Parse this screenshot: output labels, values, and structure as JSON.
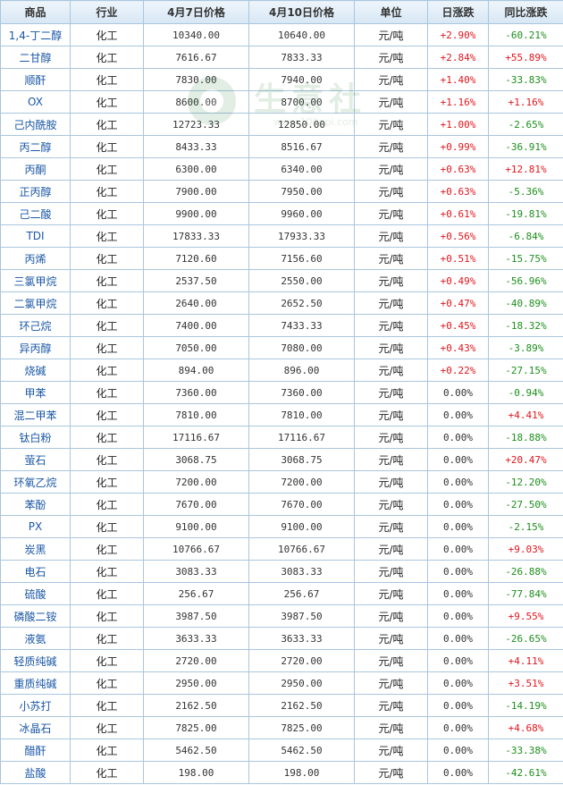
{
  "table": {
    "headers": [
      "商品",
      "行业",
      "4月7日价格",
      "4月10日价格",
      "单位",
      "日涨跌",
      "同比涨跌"
    ],
    "rows": [
      {
        "name": "1,4-丁二醇",
        "industry": "化工",
        "p1": "10340.00",
        "p2": "10640.00",
        "unit": "元/吨",
        "daily": "+2.90%",
        "yoy": "-60.21%"
      },
      {
        "name": "二甘醇",
        "industry": "化工",
        "p1": "7616.67",
        "p2": "7833.33",
        "unit": "元/吨",
        "daily": "+2.84%",
        "yoy": "+55.89%"
      },
      {
        "name": "顺酐",
        "industry": "化工",
        "p1": "7830.00",
        "p2": "7940.00",
        "unit": "元/吨",
        "daily": "+1.40%",
        "yoy": "-33.83%"
      },
      {
        "name": "OX",
        "industry": "化工",
        "p1": "8600.00",
        "p2": "8700.00",
        "unit": "元/吨",
        "daily": "+1.16%",
        "yoy": "+1.16%"
      },
      {
        "name": "己内酰胺",
        "industry": "化工",
        "p1": "12723.33",
        "p2": "12850.00",
        "unit": "元/吨",
        "daily": "+1.00%",
        "yoy": "-2.65%"
      },
      {
        "name": "丙二醇",
        "industry": "化工",
        "p1": "8433.33",
        "p2": "8516.67",
        "unit": "元/吨",
        "daily": "+0.99%",
        "yoy": "-36.91%"
      },
      {
        "name": "丙酮",
        "industry": "化工",
        "p1": "6300.00",
        "p2": "6340.00",
        "unit": "元/吨",
        "daily": "+0.63%",
        "yoy": "+12.81%"
      },
      {
        "name": "正丙醇",
        "industry": "化工",
        "p1": "7900.00",
        "p2": "7950.00",
        "unit": "元/吨",
        "daily": "+0.63%",
        "yoy": "-5.36%"
      },
      {
        "name": "己二酸",
        "industry": "化工",
        "p1": "9900.00",
        "p2": "9960.00",
        "unit": "元/吨",
        "daily": "+0.61%",
        "yoy": "-19.81%"
      },
      {
        "name": "TDI",
        "industry": "化工",
        "p1": "17833.33",
        "p2": "17933.33",
        "unit": "元/吨",
        "daily": "+0.56%",
        "yoy": "-6.84%"
      },
      {
        "name": "丙烯",
        "industry": "化工",
        "p1": "7120.60",
        "p2": "7156.60",
        "unit": "元/吨",
        "daily": "+0.51%",
        "yoy": "-15.75%"
      },
      {
        "name": "三氯甲烷",
        "industry": "化工",
        "p1": "2537.50",
        "p2": "2550.00",
        "unit": "元/吨",
        "daily": "+0.49%",
        "yoy": "-56.96%"
      },
      {
        "name": "二氯甲烷",
        "industry": "化工",
        "p1": "2640.00",
        "p2": "2652.50",
        "unit": "元/吨",
        "daily": "+0.47%",
        "yoy": "-40.89%"
      },
      {
        "name": "环己烷",
        "industry": "化工",
        "p1": "7400.00",
        "p2": "7433.33",
        "unit": "元/吨",
        "daily": "+0.45%",
        "yoy": "-18.32%"
      },
      {
        "name": "异丙醇",
        "industry": "化工",
        "p1": "7050.00",
        "p2": "7080.00",
        "unit": "元/吨",
        "daily": "+0.43%",
        "yoy": "-3.89%"
      },
      {
        "name": "烧碱",
        "industry": "化工",
        "p1": "894.00",
        "p2": "896.00",
        "unit": "元/吨",
        "daily": "+0.22%",
        "yoy": "-27.15%"
      },
      {
        "name": "甲苯",
        "industry": "化工",
        "p1": "7360.00",
        "p2": "7360.00",
        "unit": "元/吨",
        "daily": "0.00%",
        "yoy": "-0.94%"
      },
      {
        "name": "混二甲苯",
        "industry": "化工",
        "p1": "7810.00",
        "p2": "7810.00",
        "unit": "元/吨",
        "daily": "0.00%",
        "yoy": "+4.41%"
      },
      {
        "name": "钛白粉",
        "industry": "化工",
        "p1": "17116.67",
        "p2": "17116.67",
        "unit": "元/吨",
        "daily": "0.00%",
        "yoy": "-18.88%"
      },
      {
        "name": "萤石",
        "industry": "化工",
        "p1": "3068.75",
        "p2": "3068.75",
        "unit": "元/吨",
        "daily": "0.00%",
        "yoy": "+20.47%"
      },
      {
        "name": "环氧乙烷",
        "industry": "化工",
        "p1": "7200.00",
        "p2": "7200.00",
        "unit": "元/吨",
        "daily": "0.00%",
        "yoy": "-12.20%"
      },
      {
        "name": "苯酚",
        "industry": "化工",
        "p1": "7670.00",
        "p2": "7670.00",
        "unit": "元/吨",
        "daily": "0.00%",
        "yoy": "-27.50%"
      },
      {
        "name": "PX",
        "industry": "化工",
        "p1": "9100.00",
        "p2": "9100.00",
        "unit": "元/吨",
        "daily": "0.00%",
        "yoy": "-2.15%"
      },
      {
        "name": "炭黑",
        "industry": "化工",
        "p1": "10766.67",
        "p2": "10766.67",
        "unit": "元/吨",
        "daily": "0.00%",
        "yoy": "+9.03%"
      },
      {
        "name": "电石",
        "industry": "化工",
        "p1": "3083.33",
        "p2": "3083.33",
        "unit": "元/吨",
        "daily": "0.00%",
        "yoy": "-26.88%"
      },
      {
        "name": "硫酸",
        "industry": "化工",
        "p1": "256.67",
        "p2": "256.67",
        "unit": "元/吨",
        "daily": "0.00%",
        "yoy": "-77.84%"
      },
      {
        "name": "磷酸二铵",
        "industry": "化工",
        "p1": "3987.50",
        "p2": "3987.50",
        "unit": "元/吨",
        "daily": "0.00%",
        "yoy": "+9.55%"
      },
      {
        "name": "液氨",
        "industry": "化工",
        "p1": "3633.33",
        "p2": "3633.33",
        "unit": "元/吨",
        "daily": "0.00%",
        "yoy": "-26.65%"
      },
      {
        "name": "轻质纯碱",
        "industry": "化工",
        "p1": "2720.00",
        "p2": "2720.00",
        "unit": "元/吨",
        "daily": "0.00%",
        "yoy": "+4.11%"
      },
      {
        "name": "重质纯碱",
        "industry": "化工",
        "p1": "2950.00",
        "p2": "2950.00",
        "unit": "元/吨",
        "daily": "0.00%",
        "yoy": "+3.51%"
      },
      {
        "name": "小苏打",
        "industry": "化工",
        "p1": "2162.50",
        "p2": "2162.50",
        "unit": "元/吨",
        "daily": "0.00%",
        "yoy": "-14.19%"
      },
      {
        "name": "冰晶石",
        "industry": "化工",
        "p1": "7825.00",
        "p2": "7825.00",
        "unit": "元/吨",
        "daily": "0.00%",
        "yoy": "+4.68%"
      },
      {
        "name": "醋酐",
        "industry": "化工",
        "p1": "5462.50",
        "p2": "5462.50",
        "unit": "元/吨",
        "daily": "0.00%",
        "yoy": "-33.38%"
      },
      {
        "name": "盐酸",
        "industry": "化工",
        "p1": "198.00",
        "p2": "198.00",
        "unit": "元/吨",
        "daily": "0.00%",
        "yoy": "-42.61%"
      }
    ]
  },
  "watermark": {
    "text": "生意社",
    "url": "www.100ppi.com"
  },
  "colors": {
    "up": "#e0161d",
    "down": "#1c8f1c",
    "link": "#1a57a6",
    "border": "#aac6de"
  }
}
